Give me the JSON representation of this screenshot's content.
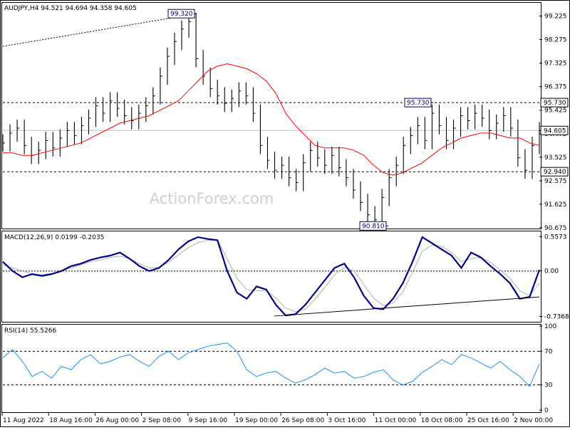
{
  "chart_data": [
    {
      "type": "line",
      "panel": "price",
      "header": "AUDJPY,H4  94.521 94.694 94.358 94.605",
      "symbol_tf": "AUDJPY,H4",
      "ohlc": {
        "open": 94.521,
        "high": 94.694,
        "low": 94.358,
        "close": 94.605
      },
      "y_ticks": [
        "99.225",
        "98.275",
        "97.325",
        "96.375",
        "95.425",
        "94.475",
        "93.525",
        "92.575",
        "91.625",
        "90.675"
      ],
      "ylim": [
        90.675,
        99.7
      ],
      "current_price": "94.605",
      "levels": [
        {
          "label": "95.730",
          "value": 95.73,
          "style": "dashed"
        },
        {
          "label": "92.940",
          "value": 92.94,
          "style": "dashed"
        }
      ],
      "annotations": [
        {
          "label": "99.320",
          "value": 99.32,
          "at": "9 Sep 16:00"
        },
        {
          "label": "95.730",
          "value": 95.73,
          "at": "18 Oct 16:00"
        },
        {
          "label": "90.810",
          "value": 90.81,
          "at": "13 Oct 00:00"
        }
      ],
      "watermark": "ActionForex.com",
      "x_ticks": [
        "11 Aug 2022",
        "18 Aug 16:00",
        "26 Aug 00:00",
        "2 Sep 08:00",
        "9 Sep 16:00",
        "19 Sep 00:00",
        "26 Sep 08:00",
        "3 Oct 16:00",
        "11 Oct 00:00",
        "18 Oct 08:00",
        "25 Oct 16:00",
        "2 Nov 00:00"
      ],
      "price_series": [
        94.1,
        94.5,
        94.7,
        94.0,
        93.6,
        93.8,
        94.2,
        93.9,
        94.3,
        94.6,
        94.4,
        94.8,
        95.1,
        95.6,
        95.3,
        95.8,
        95.5,
        95.2,
        95.0,
        95.3,
        95.6,
        96.0,
        96.8,
        97.6,
        98.2,
        98.7,
        99.0,
        97.5,
        96.8,
        96.3,
        96.0,
        95.7,
        95.9,
        96.2,
        96.0,
        95.3,
        94.0,
        93.4,
        93.0,
        93.2,
        92.7,
        92.5,
        93.3,
        93.8,
        93.5,
        93.2,
        93.6,
        93.1,
        92.7,
        92.2,
        91.7,
        91.2,
        91.0,
        91.9,
        92.7,
        93.2,
        94.0,
        94.4,
        94.8,
        94.2,
        95.3,
        94.8,
        94.2,
        94.7,
        95.2,
        95.0,
        95.3,
        95.1,
        94.6,
        94.9,
        95.2,
        94.7,
        93.5,
        93.0,
        94.0,
        94.6
      ],
      "ma_series": [
        93.7,
        93.7,
        93.6,
        93.6,
        93.7,
        93.8,
        93.9,
        94.0,
        94.1,
        94.3,
        94.5,
        94.7,
        94.9,
        95.0,
        95.1,
        95.2,
        95.4,
        95.6,
        95.8,
        96.2,
        96.6,
        97.0,
        97.2,
        97.3,
        97.2,
        97.1,
        96.9,
        96.6,
        96.1,
        95.3,
        94.8,
        94.4,
        94.0,
        93.9,
        93.9,
        93.9,
        93.8,
        93.6,
        93.2,
        92.9,
        92.8,
        92.9,
        93.1,
        93.3,
        93.6,
        93.9,
        94.1,
        94.3,
        94.4,
        94.5,
        94.5,
        94.4,
        94.3,
        94.3,
        94.1,
        94.0
      ],
      "series": [
        {
          "name": "",
          "legend_visible": false,
          "color": "#000000"
        },
        {
          "name": "",
          "legend_visible": false,
          "color": "#ff0000"
        }
      ]
    },
    {
      "type": "line",
      "panel": "macd",
      "header": "MACD(12,26,9) 0.0199 -0.2035",
      "y_ticks": [
        "0.5573",
        "0.00",
        "-0.7368"
      ],
      "ylim": [
        -0.8,
        0.62
      ],
      "macd_series": [
        0.15,
        0.0,
        -0.1,
        -0.05,
        -0.08,
        -0.05,
        0.0,
        0.08,
        0.12,
        0.18,
        0.22,
        0.25,
        0.3,
        0.2,
        0.08,
        0.0,
        0.05,
        0.18,
        0.35,
        0.48,
        0.55,
        0.52,
        0.5,
        0.0,
        -0.35,
        -0.45,
        -0.25,
        -0.3,
        -0.55,
        -0.72,
        -0.7,
        -0.55,
        -0.35,
        -0.15,
        0.05,
        0.12,
        -0.1,
        -0.4,
        -0.6,
        -0.62,
        -0.45,
        -0.2,
        0.15,
        0.55,
        0.45,
        0.35,
        0.25,
        0.05,
        0.3,
        0.22,
        0.08,
        -0.05,
        -0.2,
        -0.45,
        -0.42,
        0.02
      ],
      "signal_series": [
        0.1,
        0.05,
        0.0,
        -0.05,
        -0.06,
        -0.04,
        0.0,
        0.05,
        0.1,
        0.15,
        0.18,
        0.22,
        0.24,
        0.2,
        0.12,
        0.05,
        0.06,
        0.14,
        0.26,
        0.38,
        0.46,
        0.5,
        0.5,
        0.2,
        -0.12,
        -0.3,
        -0.32,
        -0.32,
        -0.44,
        -0.6,
        -0.66,
        -0.62,
        -0.46,
        -0.26,
        -0.06,
        0.06,
        0.0,
        -0.22,
        -0.44,
        -0.56,
        -0.52,
        -0.34,
        -0.02,
        0.32,
        0.42,
        0.4,
        0.3,
        0.15,
        0.2,
        0.22,
        0.14,
        0.02,
        -0.12,
        -0.32,
        -0.4,
        -0.2
      ],
      "trendline": [
        -0.73,
        -0.42
      ]
    },
    {
      "type": "line",
      "panel": "rsi",
      "header": "RSI(14) 55.5266",
      "y_ticks": [
        "100",
        "70",
        "30",
        "0"
      ],
      "ylim": [
        0,
        100
      ],
      "levels": [
        70,
        30
      ],
      "rsi_series": [
        62,
        72,
        58,
        40,
        46,
        38,
        52,
        48,
        60,
        66,
        55,
        58,
        63,
        66,
        58,
        52,
        64,
        70,
        60,
        68,
        72,
        76,
        78,
        80,
        70,
        48,
        40,
        44,
        46,
        38,
        32,
        36,
        42,
        50,
        44,
        46,
        38,
        40,
        45,
        48,
        36,
        30,
        34,
        45,
        52,
        60,
        54,
        66,
        62,
        56,
        50,
        58,
        48,
        40,
        28,
        55
      ]
    }
  ]
}
